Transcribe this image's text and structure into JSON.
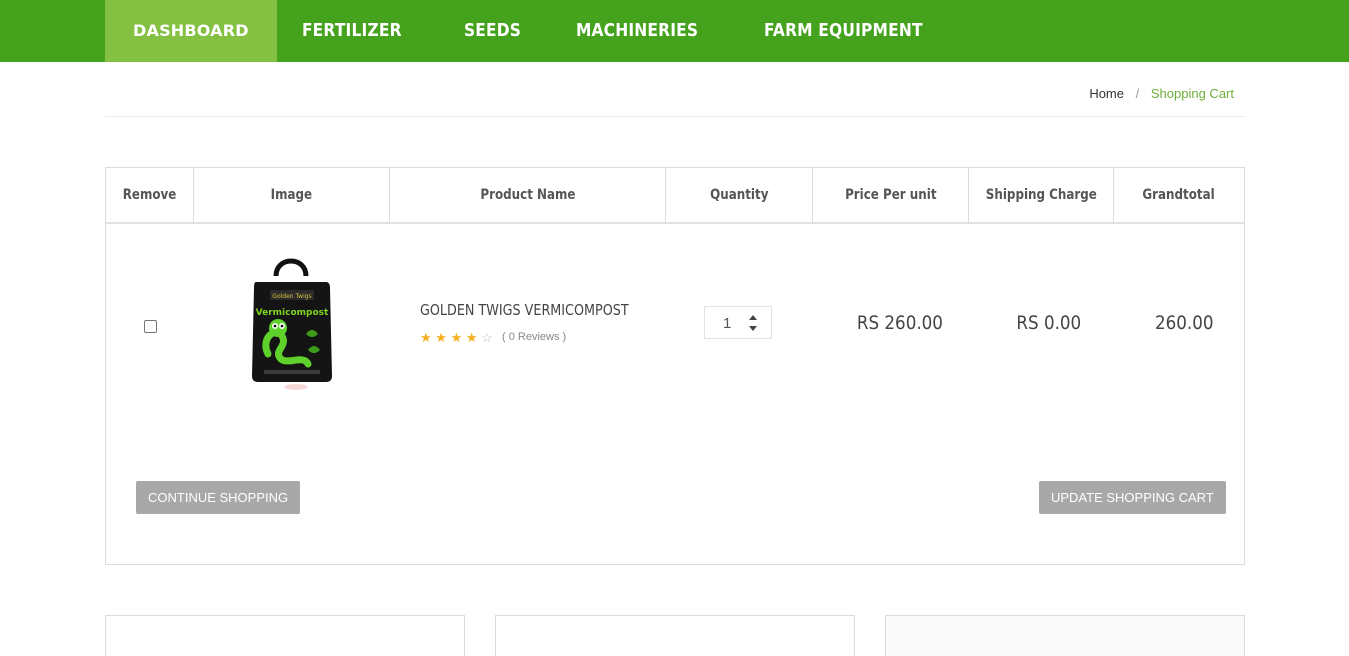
{
  "nav": {
    "items": [
      "DASHBOARD",
      "FERTILIZER",
      "SEEDS",
      "MACHINERIES",
      "FARM EQUIPMENT"
    ],
    "active_index": 0
  },
  "breadcrumb": {
    "home": "Home",
    "separator": "/",
    "current": "Shopping Cart"
  },
  "table": {
    "headers": [
      "Remove",
      "Image",
      "Product Name",
      "Quantity",
      "Price Per unit",
      "Shipping Charge",
      "Grandtotal"
    ],
    "rows": [
      {
        "product_name": "GOLDEN TWIGS VERMICOMPOST",
        "image_label": "Vermicompost",
        "rating": 4,
        "rating_max": 5,
        "reviews": "( 0 Reviews )",
        "quantity": "1",
        "price_per_unit": "RS 260.00",
        "shipping_charge": "RS 0.00",
        "grandtotal": "260.00"
      }
    ]
  },
  "buttons": {
    "continue": "CONTINUE SHOPPING",
    "update": "UPDATE SHOPPING CART"
  },
  "colors": {
    "nav_bg": "#45a21c",
    "nav_active": "#84c042",
    "accent": "#6fae3a",
    "star": "#f6b01e",
    "button_bg": "#a8a8a8"
  }
}
